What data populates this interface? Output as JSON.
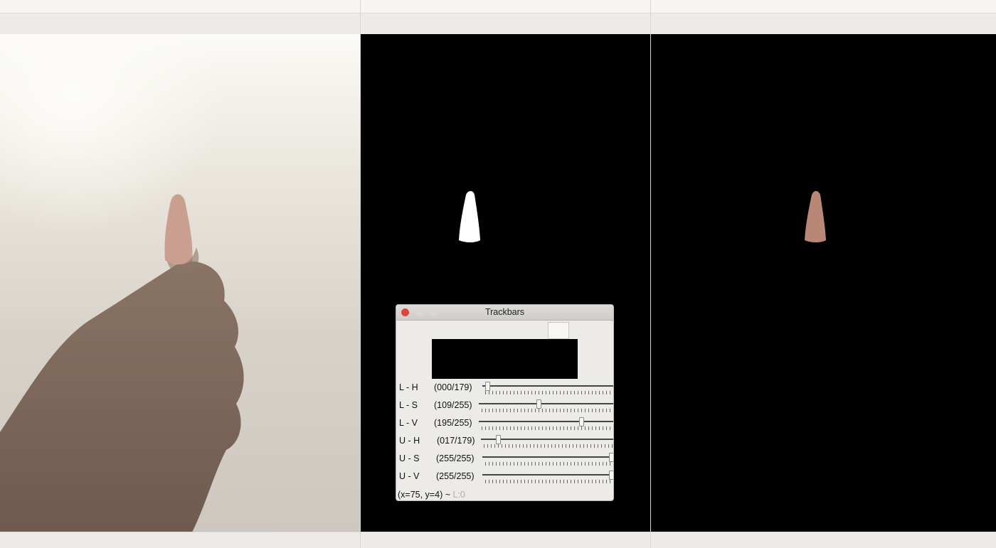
{
  "trackbars": {
    "title": "Trackbars",
    "sliders": [
      {
        "name": "L - H",
        "value_text": "(000/179)",
        "value": 0,
        "max": 179
      },
      {
        "name": "L - S",
        "value_text": "(109/255)",
        "value": 109,
        "max": 255
      },
      {
        "name": "L - V",
        "value_text": "(195/255)",
        "value": 195,
        "max": 255
      },
      {
        "name": "U - H",
        "value_text": "(017/179)",
        "value": 17,
        "max": 179
      },
      {
        "name": "U - S",
        "value_text": "(255/255)",
        "value": 255,
        "max": 255
      },
      {
        "name": "U - V",
        "value_text": "(255/255)",
        "value": 255,
        "max": 255
      }
    ],
    "status": "(x=75, y=4) ~",
    "status_extra": "L:0"
  },
  "colors": {
    "close": "#e0443e",
    "minimize": "#d9d7d3",
    "zoom": "#d9d7d3",
    "skin": "#b98776",
    "mask": "#ffffff"
  }
}
